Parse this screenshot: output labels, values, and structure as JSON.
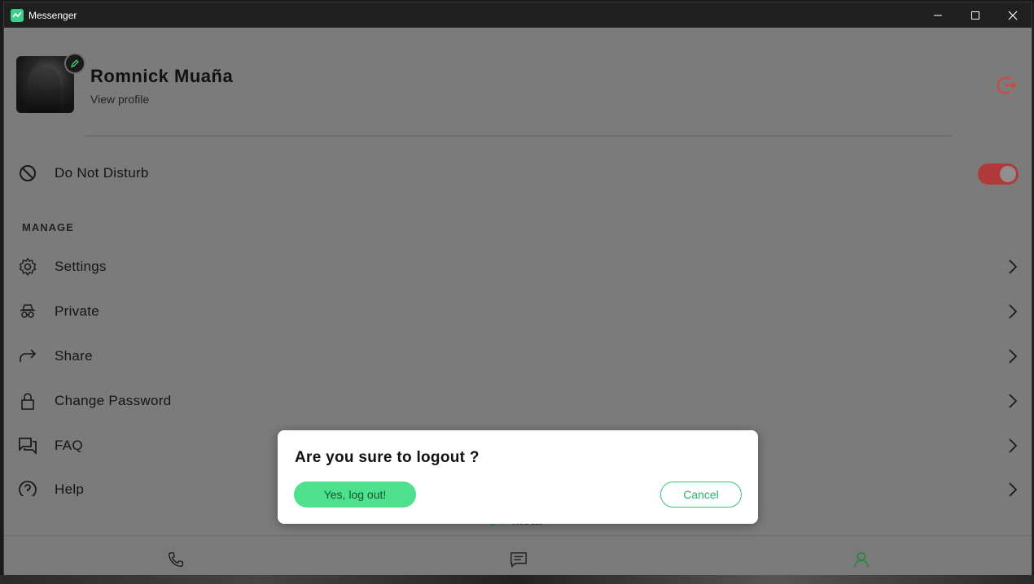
{
  "window": {
    "title": "Messenger"
  },
  "profile": {
    "name": "Romnick Muaña",
    "view_profile": "View profile"
  },
  "dnd": {
    "label": "Do Not Disturb",
    "enabled": true
  },
  "manage": {
    "heading": "MANAGE",
    "items": [
      {
        "label": "Settings",
        "icon": "gear-icon"
      },
      {
        "label": "Private",
        "icon": "spy-icon"
      },
      {
        "label": "Share",
        "icon": "share-arrow-icon"
      },
      {
        "label": "Change Password",
        "icon": "lock-icon"
      },
      {
        "label": "FAQ",
        "icon": "chat-bubbles-icon"
      },
      {
        "label": "Help",
        "icon": "help-circle-icon"
      }
    ]
  },
  "footer": {
    "brand": "Meta"
  },
  "bottom_nav": {
    "active": "profile"
  },
  "dialog": {
    "title": "Are you sure to logout ?",
    "confirm_label": "Yes, log out!",
    "cancel_label": "Cancel"
  },
  "colors": {
    "accent": "#4fe08d",
    "danger": "#d9453a",
    "toggle_on": "#b03a3a"
  }
}
